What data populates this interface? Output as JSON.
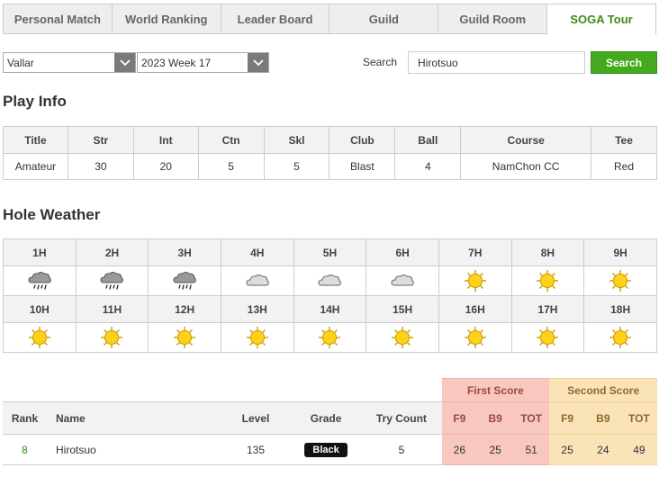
{
  "tabs": [
    {
      "label": "Personal Match",
      "active": false
    },
    {
      "label": "World Ranking",
      "active": false
    },
    {
      "label": "Leader Board",
      "active": false
    },
    {
      "label": "Guild",
      "active": false
    },
    {
      "label": "Guild Room",
      "active": false
    },
    {
      "label": "SOGA Tour",
      "active": true
    }
  ],
  "filters": {
    "server": "Vallar",
    "week": "2023 Week 17",
    "search_label": "Search",
    "search_value": "Hirotsuo",
    "search_button": "Search"
  },
  "play_info": {
    "title": "Play Info",
    "headers": [
      "Title",
      "Str",
      "Int",
      "Ctn",
      "Skl",
      "Club",
      "Ball",
      "Course",
      "Tee"
    ],
    "values": [
      "Amateur",
      "30",
      "20",
      "5",
      "5",
      "Blast",
      "4",
      "NamChon CC",
      "Red"
    ]
  },
  "hole_weather": {
    "title": "Hole Weather",
    "row1": {
      "holes": [
        "1H",
        "2H",
        "3H",
        "4H",
        "5H",
        "6H",
        "7H",
        "8H",
        "9H"
      ],
      "weather": [
        "rain-cloud-icon",
        "rain-cloud-icon",
        "rain-cloud-icon",
        "cloud-icon",
        "cloud-icon",
        "cloud-icon",
        "sun-icon",
        "sun-icon",
        "sun-icon"
      ]
    },
    "row2": {
      "holes": [
        "10H",
        "11H",
        "12H",
        "13H",
        "14H",
        "15H",
        "16H",
        "17H",
        "18H"
      ],
      "weather": [
        "sun-icon",
        "sun-icon",
        "sun-icon",
        "sun-icon",
        "sun-icon",
        "sun-icon",
        "sun-icon",
        "sun-icon",
        "sun-icon"
      ]
    }
  },
  "scores": {
    "first_score": "First Score",
    "second_score": "Second Score",
    "headers": {
      "rank": "Rank",
      "name": "Name",
      "level": "Level",
      "grade": "Grade",
      "try_count": "Try Count",
      "f9": "F9",
      "b9": "B9",
      "tot": "TOT"
    },
    "row": {
      "rank": "8",
      "name": "Hirotsuo",
      "level": "135",
      "grade": "Black",
      "try_count": "5",
      "first": {
        "f9": "26",
        "b9": "25",
        "tot": "51"
      },
      "second": {
        "f9": "25",
        "b9": "24",
        "tot": "49"
      }
    }
  }
}
